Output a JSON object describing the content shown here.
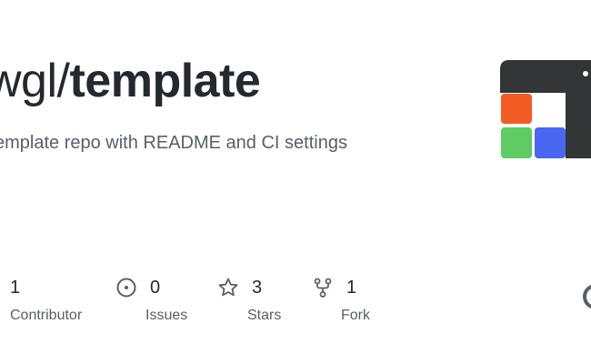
{
  "repo": {
    "owner": "wgl/",
    "name": "template",
    "description": "Template repo with README and CI settings"
  },
  "stats": [
    {
      "value": "1",
      "label": "Contributor",
      "icon": "people-icon"
    },
    {
      "value": "0",
      "label": "Issues",
      "icon": "issue-icon"
    },
    {
      "value": "3",
      "label": "Stars",
      "icon": "star-icon"
    },
    {
      "value": "1",
      "label": "Fork",
      "icon": "fork-icon"
    }
  ],
  "colors": {
    "title": "#24292f",
    "muted": "#57606a",
    "logo_dark": "#333536",
    "logo_orange": "#f25b22",
    "logo_green": "#5ecb63",
    "logo_blue": "#4a67f2"
  }
}
